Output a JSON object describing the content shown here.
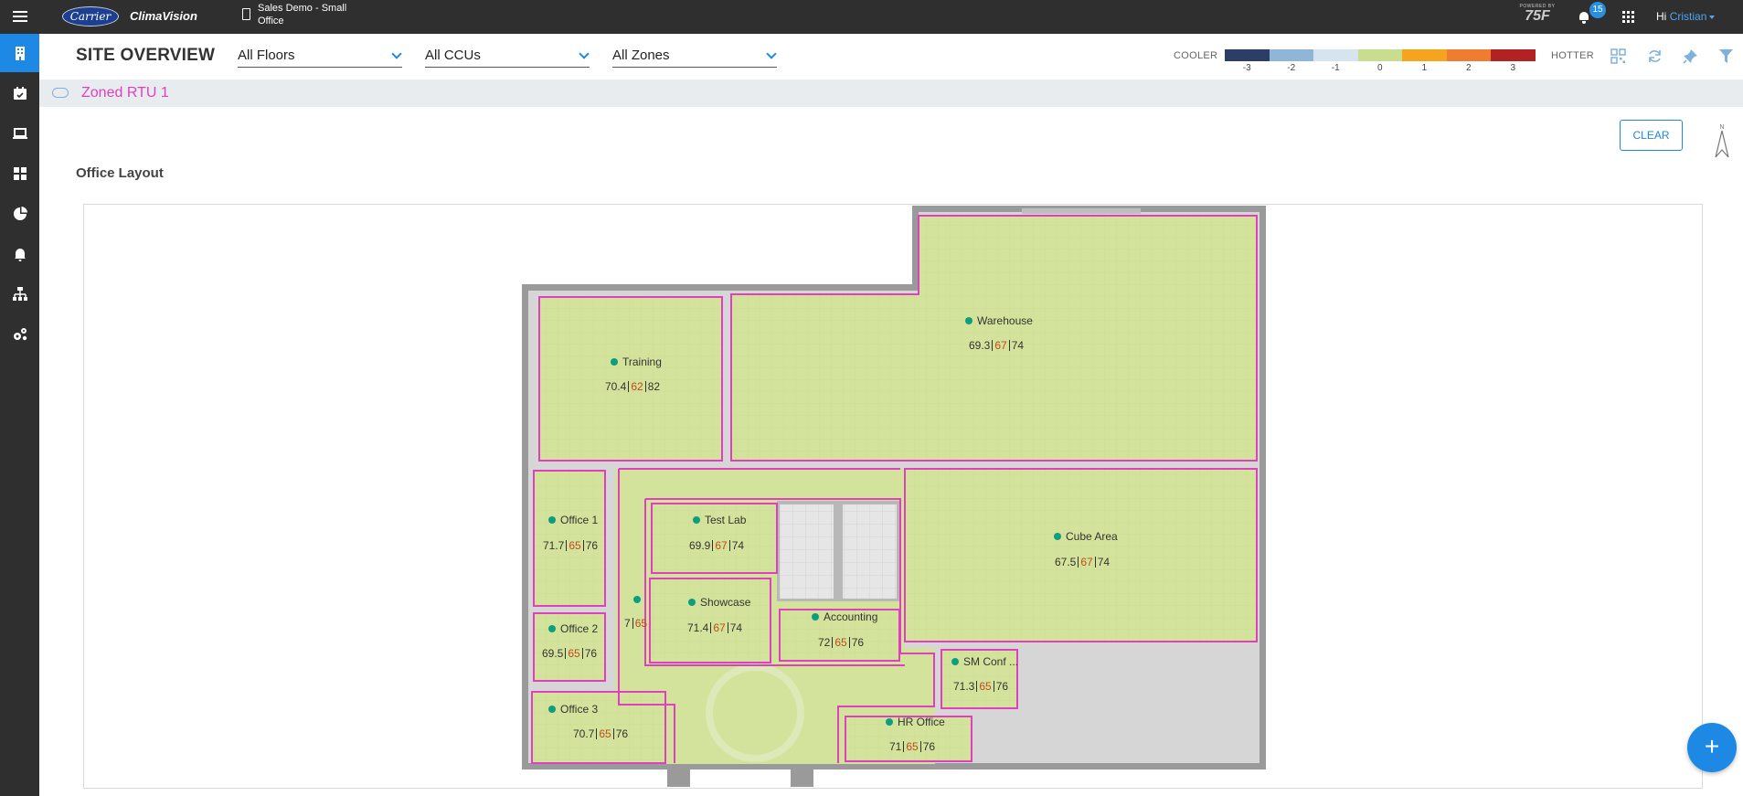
{
  "topbar": {
    "brand_logo": "Carrier",
    "product_name": "ClimaVision",
    "site_name": "Sales Demo - Small Office",
    "powered_by": "POWERED BY",
    "powered_logo": "75F",
    "notification_count": "15",
    "greeting": "Hi",
    "user_name": "Cristian"
  },
  "sidebar": {
    "items": [
      {
        "icon": "building-icon",
        "active": true
      },
      {
        "icon": "calendar-check-icon",
        "active": false
      },
      {
        "icon": "laptop-icon",
        "active": false
      },
      {
        "icon": "dashboard-grid-icon",
        "active": false
      },
      {
        "icon": "pie-chart-icon",
        "active": false
      },
      {
        "icon": "bell-icon",
        "active": false
      },
      {
        "icon": "org-chart-icon",
        "active": false
      },
      {
        "icon": "settings-gears-icon",
        "active": false
      }
    ]
  },
  "header": {
    "title": "SITE OVERVIEW",
    "filters": {
      "floors": "All Floors",
      "ccus": "All CCUs",
      "zones": "All Zones"
    },
    "legend": {
      "cooler_label": "COOLER",
      "hotter_label": "HOTTER",
      "scale": [
        {
          "value": "-3",
          "color": "#2c3e66"
        },
        {
          "value": "-2",
          "color": "#8fb6d6"
        },
        {
          "value": "-1",
          "color": "#d6e4f0"
        },
        {
          "value": "0",
          "color": "#c9dd8e"
        },
        {
          "value": "1",
          "color": "#f5a41d"
        },
        {
          "value": "2",
          "color": "#ef7d31"
        },
        {
          "value": "3",
          "color": "#b22222"
        }
      ]
    },
    "tools": [
      "qr-code-icon",
      "refresh-icon",
      "pin-icon",
      "filter-icon"
    ]
  },
  "ccu_bar": {
    "name": "Zoned RTU 1"
  },
  "layout": {
    "clear_label": "CLEAR",
    "north_label": "N",
    "section_title": "Office Layout",
    "zone_fill": "#d3e39b",
    "zone_outline": "#e040c0",
    "zones": [
      {
        "id": "training",
        "name": "Training",
        "current": "70.4",
        "cool": "62",
        "heat": "82"
      },
      {
        "id": "warehouse",
        "name": "Warehouse",
        "current": "69.3",
        "cool": "67",
        "heat": "74"
      },
      {
        "id": "office-1",
        "name": "Office 1",
        "current": "71.7",
        "cool": "65",
        "heat": "76"
      },
      {
        "id": "test-lab",
        "name": "Test Lab",
        "current": "69.9",
        "cool": "67",
        "heat": "74"
      },
      {
        "id": "cube-area",
        "name": "Cube Area",
        "current": "67.5",
        "cool": "67",
        "heat": "74"
      },
      {
        "id": "showcase",
        "name": "Showcase",
        "current": "71.4",
        "cool": "67",
        "heat": "74"
      },
      {
        "id": "office-2",
        "name": "Office 2",
        "current": "69.5",
        "cool": "65",
        "heat": "76"
      },
      {
        "id": "accounting",
        "name": "Accounting",
        "current": "72",
        "cool": "65",
        "heat": "76"
      },
      {
        "id": "sm-conf",
        "name": "SM Conf ...",
        "current": "71.3",
        "cool": "65",
        "heat": "76"
      },
      {
        "id": "office-3",
        "name": "Office 3",
        "current": "70.7",
        "cool": "65",
        "heat": "76"
      },
      {
        "id": "hr-office",
        "name": "HR Office",
        "current": "71",
        "cool": "65",
        "heat": "76"
      },
      {
        "id": "lobby",
        "name": "",
        "current": "7",
        "cool": "65",
        "heat": ""
      }
    ]
  },
  "fab": {
    "label": "+"
  }
}
